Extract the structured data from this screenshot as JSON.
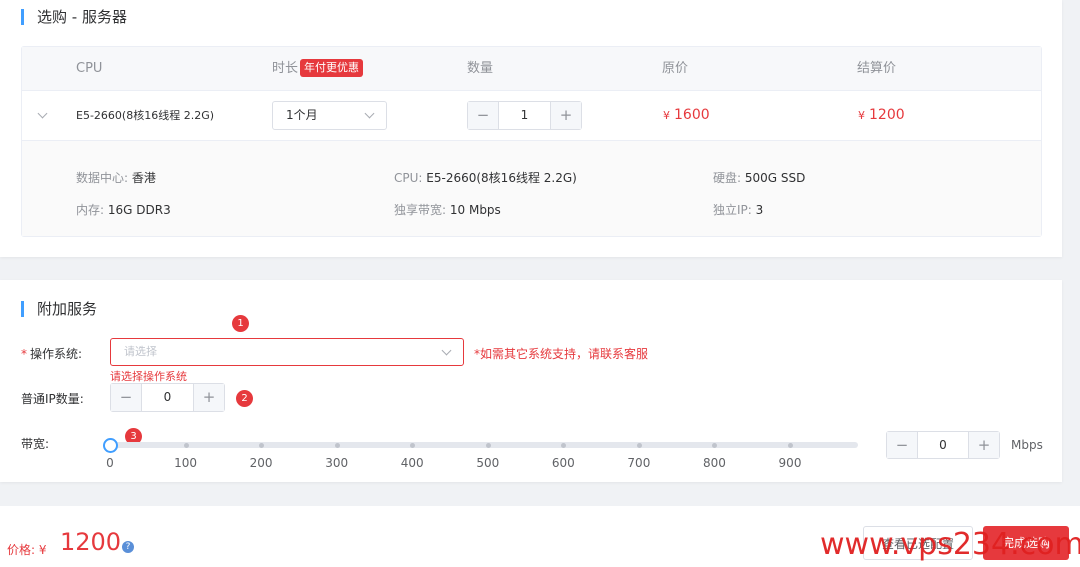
{
  "server": {
    "title": "选购 - 服务器",
    "columns": {
      "cpu": "CPU",
      "duration": "时长",
      "duration_tag": "年付更优惠",
      "quantity": "数量",
      "original_price": "原价",
      "settle_price": "结算价"
    },
    "row": {
      "cpu": "E5-2660(8核16线程 2.2G)",
      "duration": "1个月",
      "quantity": "1",
      "currency": "¥",
      "original_price": "1600",
      "settle_price": "1200",
      "minus": "−",
      "plus": "+"
    },
    "details": {
      "datacenter_label": "数据中心:",
      "datacenter": "香港",
      "cpu_label": "CPU:",
      "cpu": "E5-2660(8核16线程 2.2G)",
      "disk_label": "硬盘:",
      "disk": "500G SSD",
      "memory_label": "内存:",
      "memory": "16G DDR3",
      "bandwidth_label": "独享带宽:",
      "bandwidth": "10 Mbps",
      "ip_label": "独立IP:",
      "ip": "3"
    }
  },
  "addon": {
    "title": "附加服务",
    "os": {
      "required": "*",
      "label": "操作系统:",
      "placeholder": "请选择",
      "hint": "*如需其它系统支持，请联系客服",
      "error": "请选择操作系统"
    },
    "ip": {
      "label": "普通IP数量:",
      "value": "0",
      "minus": "−",
      "plus": "+"
    },
    "bandwidth": {
      "label": "带宽:",
      "value": "0",
      "unit": "Mbps",
      "ticks": [
        "0",
        "100",
        "200",
        "300",
        "400",
        "500",
        "600",
        "700",
        "800",
        "900"
      ],
      "slider_value": 0,
      "slider_max": 990,
      "minus": "−",
      "plus": "+"
    },
    "badges": [
      "1",
      "2",
      "3"
    ]
  },
  "footer": {
    "price_label": "价格:",
    "currency": "¥",
    "price": "1200",
    "help_icon": "?",
    "config_button": "查看已选配置",
    "submit_button": "完成选购",
    "watermark": "www.vps234.com"
  },
  "colors": {
    "accent": "#409eff",
    "danger": "#e6393d"
  }
}
